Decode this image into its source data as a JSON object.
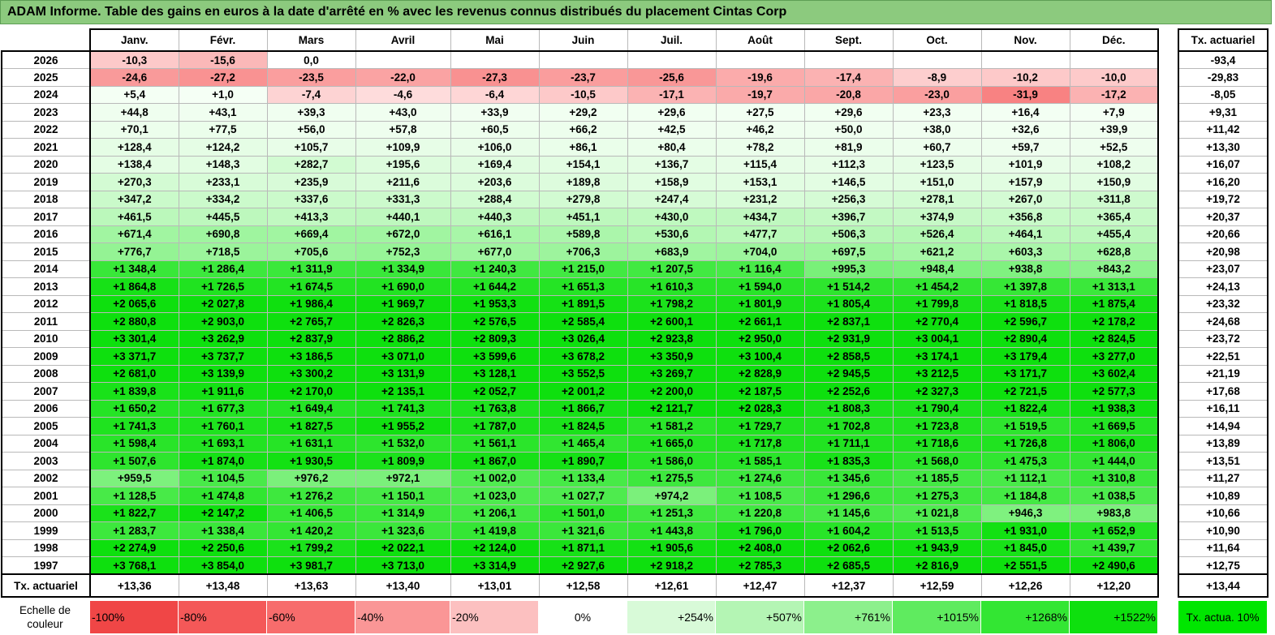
{
  "title": "ADAM Informe. Table des gains en euros à la date d'arrêté en % avec les revenus connus distribués du placement Cintas Corp",
  "months": [
    "Janv.",
    "Févr.",
    "Mars",
    "Avril",
    "Mai",
    "Juin",
    "Juil.",
    "Août",
    "Sept.",
    "Oct.",
    "Nov.",
    "Déc."
  ],
  "side_header": "Tx. actuariel",
  "rows": [
    {
      "year": "2026",
      "values": [
        "-10,3",
        "-15,6",
        "0,0",
        "",
        "",
        "",
        "",
        "",
        "",
        "",
        "",
        ""
      ],
      "rate": "-93,4"
    },
    {
      "year": "2025",
      "values": [
        "-24,6",
        "-27,2",
        "-23,5",
        "-22,0",
        "-27,3",
        "-23,7",
        "-25,6",
        "-19,6",
        "-17,4",
        "-8,9",
        "-10,2",
        "-10,0"
      ],
      "rate": "-29,83"
    },
    {
      "year": "2024",
      "values": [
        "+5,4",
        "+1,0",
        "-7,4",
        "-4,6",
        "-6,4",
        "-10,5",
        "-17,1",
        "-19,7",
        "-20,8",
        "-23,0",
        "-31,9",
        "-17,2"
      ],
      "rate": "-8,05"
    },
    {
      "year": "2023",
      "values": [
        "+44,8",
        "+43,1",
        "+39,3",
        "+43,0",
        "+33,9",
        "+29,2",
        "+29,6",
        "+27,5",
        "+29,6",
        "+23,3",
        "+16,4",
        "+7,9"
      ],
      "rate": "+9,31"
    },
    {
      "year": "2022",
      "values": [
        "+70,1",
        "+77,5",
        "+56,0",
        "+57,8",
        "+60,5",
        "+66,2",
        "+42,5",
        "+46,2",
        "+50,0",
        "+38,0",
        "+32,6",
        "+39,9"
      ],
      "rate": "+11,42"
    },
    {
      "year": "2021",
      "values": [
        "+128,4",
        "+124,2",
        "+105,7",
        "+109,9",
        "+106,0",
        "+86,1",
        "+80,4",
        "+78,2",
        "+81,9",
        "+60,7",
        "+59,7",
        "+52,5"
      ],
      "rate": "+13,30"
    },
    {
      "year": "2020",
      "values": [
        "+138,4",
        "+148,3",
        "+282,7",
        "+195,6",
        "+169,4",
        "+154,1",
        "+136,7",
        "+115,4",
        "+112,3",
        "+123,5",
        "+101,9",
        "+108,2"
      ],
      "rate": "+16,07"
    },
    {
      "year": "2019",
      "values": [
        "+270,3",
        "+233,1",
        "+235,9",
        "+211,6",
        "+203,6",
        "+189,8",
        "+158,9",
        "+153,1",
        "+146,5",
        "+151,0",
        "+157,9",
        "+150,9"
      ],
      "rate": "+16,20"
    },
    {
      "year": "2018",
      "values": [
        "+347,2",
        "+334,2",
        "+337,6",
        "+331,3",
        "+288,4",
        "+279,8",
        "+247,4",
        "+231,2",
        "+256,3",
        "+278,1",
        "+267,0",
        "+311,8"
      ],
      "rate": "+19,72"
    },
    {
      "year": "2017",
      "values": [
        "+461,5",
        "+445,5",
        "+413,3",
        "+440,1",
        "+440,3",
        "+451,1",
        "+430,0",
        "+434,7",
        "+396,7",
        "+374,9",
        "+356,8",
        "+365,4"
      ],
      "rate": "+20,37"
    },
    {
      "year": "2016",
      "values": [
        "+671,4",
        "+690,8",
        "+669,4",
        "+672,0",
        "+616,1",
        "+589,8",
        "+530,6",
        "+477,7",
        "+506,3",
        "+526,4",
        "+464,1",
        "+455,4"
      ],
      "rate": "+20,66"
    },
    {
      "year": "2015",
      "values": [
        "+776,7",
        "+718,5",
        "+705,6",
        "+752,3",
        "+677,0",
        "+706,3",
        "+683,9",
        "+704,0",
        "+697,5",
        "+621,2",
        "+603,3",
        "+628,8"
      ],
      "rate": "+20,98"
    },
    {
      "year": "2014",
      "values": [
        "+1 348,4",
        "+1 286,4",
        "+1 311,9",
        "+1 334,9",
        "+1 240,3",
        "+1 215,0",
        "+1 207,5",
        "+1 116,4",
        "+995,3",
        "+948,4",
        "+938,8",
        "+843,2"
      ],
      "rate": "+23,07"
    },
    {
      "year": "2013",
      "values": [
        "+1 864,8",
        "+1 726,5",
        "+1 674,5",
        "+1 690,0",
        "+1 644,2",
        "+1 651,3",
        "+1 610,3",
        "+1 594,0",
        "+1 514,2",
        "+1 454,2",
        "+1 397,8",
        "+1 313,1"
      ],
      "rate": "+24,13"
    },
    {
      "year": "2012",
      "values": [
        "+2 065,6",
        "+2 027,8",
        "+1 986,4",
        "+1 969,7",
        "+1 953,3",
        "+1 891,5",
        "+1 798,2",
        "+1 801,9",
        "+1 805,4",
        "+1 799,8",
        "+1 818,5",
        "+1 875,4"
      ],
      "rate": "+23,32"
    },
    {
      "year": "2011",
      "values": [
        "+2 880,8",
        "+2 903,0",
        "+2 765,7",
        "+2 826,3",
        "+2 576,5",
        "+2 585,4",
        "+2 600,1",
        "+2 661,1",
        "+2 837,1",
        "+2 770,4",
        "+2 596,7",
        "+2 178,2"
      ],
      "rate": "+24,68"
    },
    {
      "year": "2010",
      "values": [
        "+3 301,4",
        "+3 262,9",
        "+2 837,9",
        "+2 886,2",
        "+2 809,3",
        "+3 026,4",
        "+2 923,8",
        "+2 950,0",
        "+2 931,9",
        "+3 004,1",
        "+2 890,4",
        "+2 824,5"
      ],
      "rate": "+23,72"
    },
    {
      "year": "2009",
      "values": [
        "+3 371,7",
        "+3 737,7",
        "+3 186,5",
        "+3 071,0",
        "+3 599,6",
        "+3 678,2",
        "+3 350,9",
        "+3 100,4",
        "+2 858,5",
        "+3 174,1",
        "+3 179,4",
        "+3 277,0"
      ],
      "rate": "+22,51"
    },
    {
      "year": "2008",
      "values": [
        "+2 681,0",
        "+3 139,9",
        "+3 300,2",
        "+3 131,9",
        "+3 128,1",
        "+3 552,5",
        "+3 269,7",
        "+2 828,9",
        "+2 945,5",
        "+3 212,5",
        "+3 171,7",
        "+3 602,4"
      ],
      "rate": "+21,19"
    },
    {
      "year": "2007",
      "values": [
        "+1 839,8",
        "+1 911,6",
        "+2 170,0",
        "+2 135,1",
        "+2 052,7",
        "+2 001,2",
        "+2 200,0",
        "+2 187,5",
        "+2 252,6",
        "+2 327,3",
        "+2 721,5",
        "+2 577,3"
      ],
      "rate": "+17,68"
    },
    {
      "year": "2006",
      "values": [
        "+1 650,2",
        "+1 677,3",
        "+1 649,4",
        "+1 741,3",
        "+1 763,8",
        "+1 866,7",
        "+2 121,7",
        "+2 028,3",
        "+1 808,3",
        "+1 790,4",
        "+1 822,4",
        "+1 938,3"
      ],
      "rate": "+16,11"
    },
    {
      "year": "2005",
      "values": [
        "+1 741,3",
        "+1 760,1",
        "+1 827,5",
        "+1 955,2",
        "+1 787,0",
        "+1 824,5",
        "+1 581,2",
        "+1 729,7",
        "+1 702,8",
        "+1 723,8",
        "+1 519,5",
        "+1 669,5"
      ],
      "rate": "+14,94"
    },
    {
      "year": "2004",
      "values": [
        "+1 598,4",
        "+1 693,1",
        "+1 631,1",
        "+1 532,0",
        "+1 561,1",
        "+1 465,4",
        "+1 665,0",
        "+1 717,8",
        "+1 711,1",
        "+1 718,6",
        "+1 726,8",
        "+1 806,0"
      ],
      "rate": "+13,89"
    },
    {
      "year": "2003",
      "values": [
        "+1 507,6",
        "+1 874,0",
        "+1 930,5",
        "+1 809,9",
        "+1 867,0",
        "+1 890,7",
        "+1 586,0",
        "+1 585,1",
        "+1 835,3",
        "+1 568,0",
        "+1 475,3",
        "+1 444,0"
      ],
      "rate": "+13,51"
    },
    {
      "year": "2002",
      "values": [
        "+959,5",
        "+1 104,5",
        "+976,2",
        "+972,1",
        "+1 002,0",
        "+1 133,4",
        "+1 275,5",
        "+1 274,6",
        "+1 345,6",
        "+1 185,5",
        "+1 112,1",
        "+1 310,8"
      ],
      "rate": "+11,27"
    },
    {
      "year": "2001",
      "values": [
        "+1 128,5",
        "+1 474,8",
        "+1 276,2",
        "+1 150,1",
        "+1 023,0",
        "+1 027,7",
        "+974,2",
        "+1 108,5",
        "+1 296,6",
        "+1 275,3",
        "+1 184,8",
        "+1 038,5"
      ],
      "rate": "+10,89"
    },
    {
      "year": "2000",
      "values": [
        "+1 822,7",
        "+2 147,2",
        "+1 406,5",
        "+1 314,9",
        "+1 206,1",
        "+1 501,0",
        "+1 251,3",
        "+1 220,8",
        "+1 145,6",
        "+1 021,8",
        "+946,3",
        "+983,8"
      ],
      "rate": "+10,66"
    },
    {
      "year": "1999",
      "values": [
        "+1 283,7",
        "+1 338,4",
        "+1 420,2",
        "+1 323,6",
        "+1 419,8",
        "+1 321,6",
        "+1 443,8",
        "+1 796,0",
        "+1 604,2",
        "+1 513,5",
        "+1 931,0",
        "+1 652,9"
      ],
      "rate": "+10,90"
    },
    {
      "year": "1998",
      "values": [
        "+2 274,9",
        "+2 250,6",
        "+1 799,2",
        "+2 022,1",
        "+2 124,0",
        "+1 871,1",
        "+1 905,6",
        "+2 408,0",
        "+2 062,6",
        "+1 943,9",
        "+1 845,0",
        "+1 439,7"
      ],
      "rate": "+11,64"
    },
    {
      "year": "1997",
      "values": [
        "+3 768,1",
        "+3 854,0",
        "+3 981,7",
        "+3 713,0",
        "+3 314,9",
        "+2 927,6",
        "+2 918,2",
        "+2 785,3",
        "+2 685,5",
        "+2 816,9",
        "+2 551,5",
        "+2 490,6"
      ],
      "rate": "+12,75"
    }
  ],
  "totals": {
    "label": "Tx. actuariel",
    "values": [
      "+13,36",
      "+13,48",
      "+13,63",
      "+13,40",
      "+13,01",
      "+12,58",
      "+12,61",
      "+12,47",
      "+12,37",
      "+12,59",
      "+12,26",
      "+12,20"
    ],
    "rate": "+13,44"
  },
  "legend": {
    "label": "Echelle de couleur",
    "items": [
      {
        "text": "-100%",
        "color": "#f04646",
        "align": "l"
      },
      {
        "text": "-80%",
        "color": "#f45858",
        "align": "l"
      },
      {
        "text": "-60%",
        "color": "#f76c6c",
        "align": "l"
      },
      {
        "text": "-40%",
        "color": "#fa9696",
        "align": "l"
      },
      {
        "text": "-20%",
        "color": "#fcc0c0",
        "align": "l"
      },
      {
        "text": "0%",
        "color": "#ffffff",
        "align": "c"
      },
      {
        "text": "+254%",
        "color": "#d8fad8",
        "align": "r"
      },
      {
        "text": "+507%",
        "color": "#b4f5b4",
        "align": "r"
      },
      {
        "text": "+761%",
        "color": "#8cf08c",
        "align": "r"
      },
      {
        "text": "+1015%",
        "color": "#5feb5f",
        "align": "r"
      },
      {
        "text": "+1268%",
        "color": "#33e633",
        "align": "r"
      },
      {
        "text": "+1522%",
        "color": "#0ee00e",
        "align": "r"
      }
    ],
    "side": "Tx. actua. 10%"
  }
}
